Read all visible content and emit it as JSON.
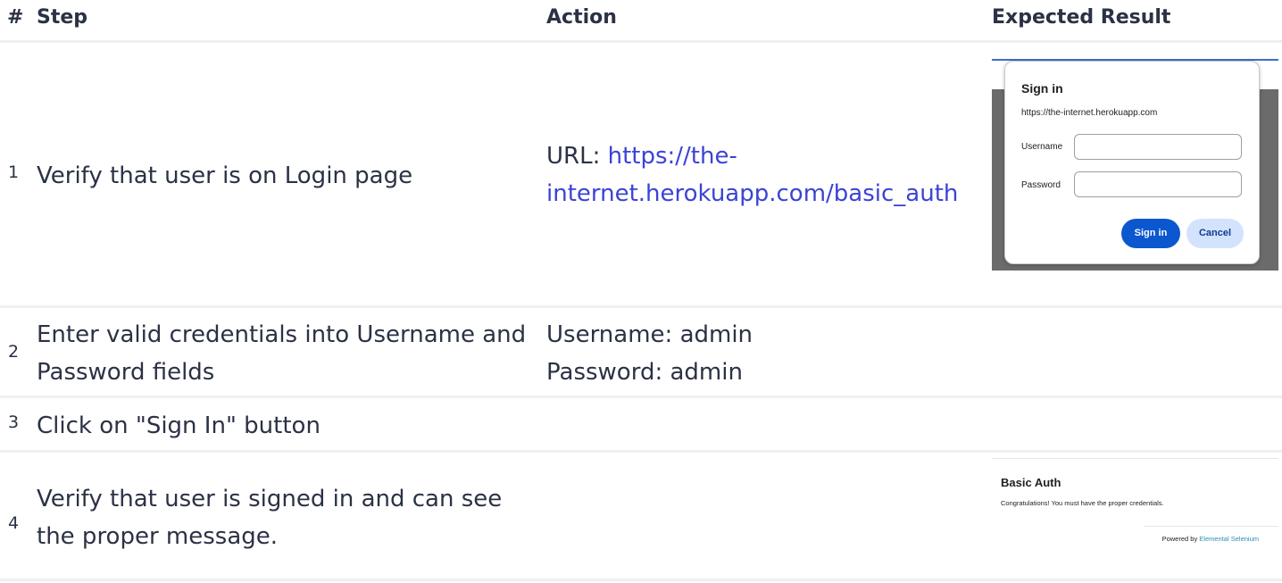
{
  "headers": {
    "num": "#",
    "step": "Step",
    "action": "Action",
    "expected": "Expected Result"
  },
  "rows": [
    {
      "num": "1",
      "step": "Verify that user is on Login page",
      "action_prefix": "URL: ",
      "action_link_line1": "https://the-",
      "action_link_line2": "internet.herokuapp.com/basic_auth"
    },
    {
      "num": "2",
      "step_line1": "Enter valid credentials into Username and",
      "step_line2": "Password fields",
      "action_line1": "Username: admin",
      "action_line2": "Password: admin"
    },
    {
      "num": "3",
      "step": "Click on \"Sign In\" button"
    },
    {
      "num": "4",
      "step_line1": "Verify that user is signed in and can see",
      "step_line2": "the proper message."
    }
  ],
  "signin_dialog": {
    "title": "Sign in",
    "url": "https://the-internet.herokuapp.com",
    "username_label": "Username",
    "password_label": "Password",
    "signin_button": "Sign in",
    "cancel_button": "Cancel"
  },
  "basic_auth_page": {
    "title": "Basic Auth",
    "message": "Congratulations! You must have the proper credentials.",
    "powered_by": "Powered by ",
    "powered_link": "Elemental Selenium"
  },
  "colors": {
    "text": "#2b3245",
    "link": "#3b43d6",
    "accent_blue": "#0b57d0"
  }
}
